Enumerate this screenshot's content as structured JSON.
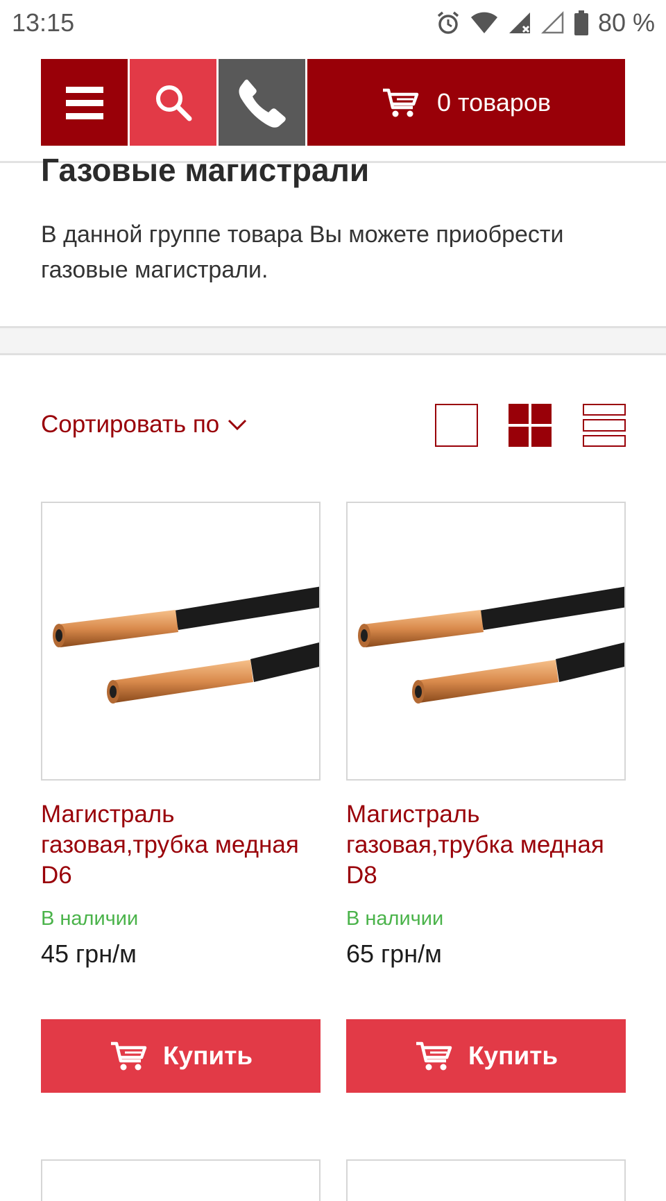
{
  "status_bar": {
    "time": "13:15",
    "battery_text": "80 %",
    "icons": [
      "alarm-icon",
      "wifi-icon",
      "signal-icon",
      "signal-empty-icon",
      "battery-icon"
    ]
  },
  "header": {
    "menu_icon": "hamburger-icon",
    "search_icon": "search-icon",
    "phone_icon": "phone-icon",
    "cart_icon": "cart-icon",
    "cart_label": "0 товаров",
    "colors": {
      "primary": "#990008",
      "accent": "#e23a47",
      "gray": "#595959"
    }
  },
  "page": {
    "title": "Газовые магистрали",
    "intro": "В данной группе товара Вы можете приобрести газовые магистрали."
  },
  "toolbar": {
    "sort_label": "Сортировать по",
    "view_modes": [
      "single-view-icon",
      "grid-view-icon",
      "list-view-icon"
    ],
    "active_view": "grid"
  },
  "products": [
    {
      "name": "Магистраль газовая,трубка медная D6",
      "stock": "В наличии",
      "price": "45 грн/м",
      "buy_label": "Купить"
    },
    {
      "name": "Магистраль газовая,трубка медная D8",
      "stock": "В наличии",
      "price": "65 грн/м",
      "buy_label": "Купить"
    }
  ]
}
